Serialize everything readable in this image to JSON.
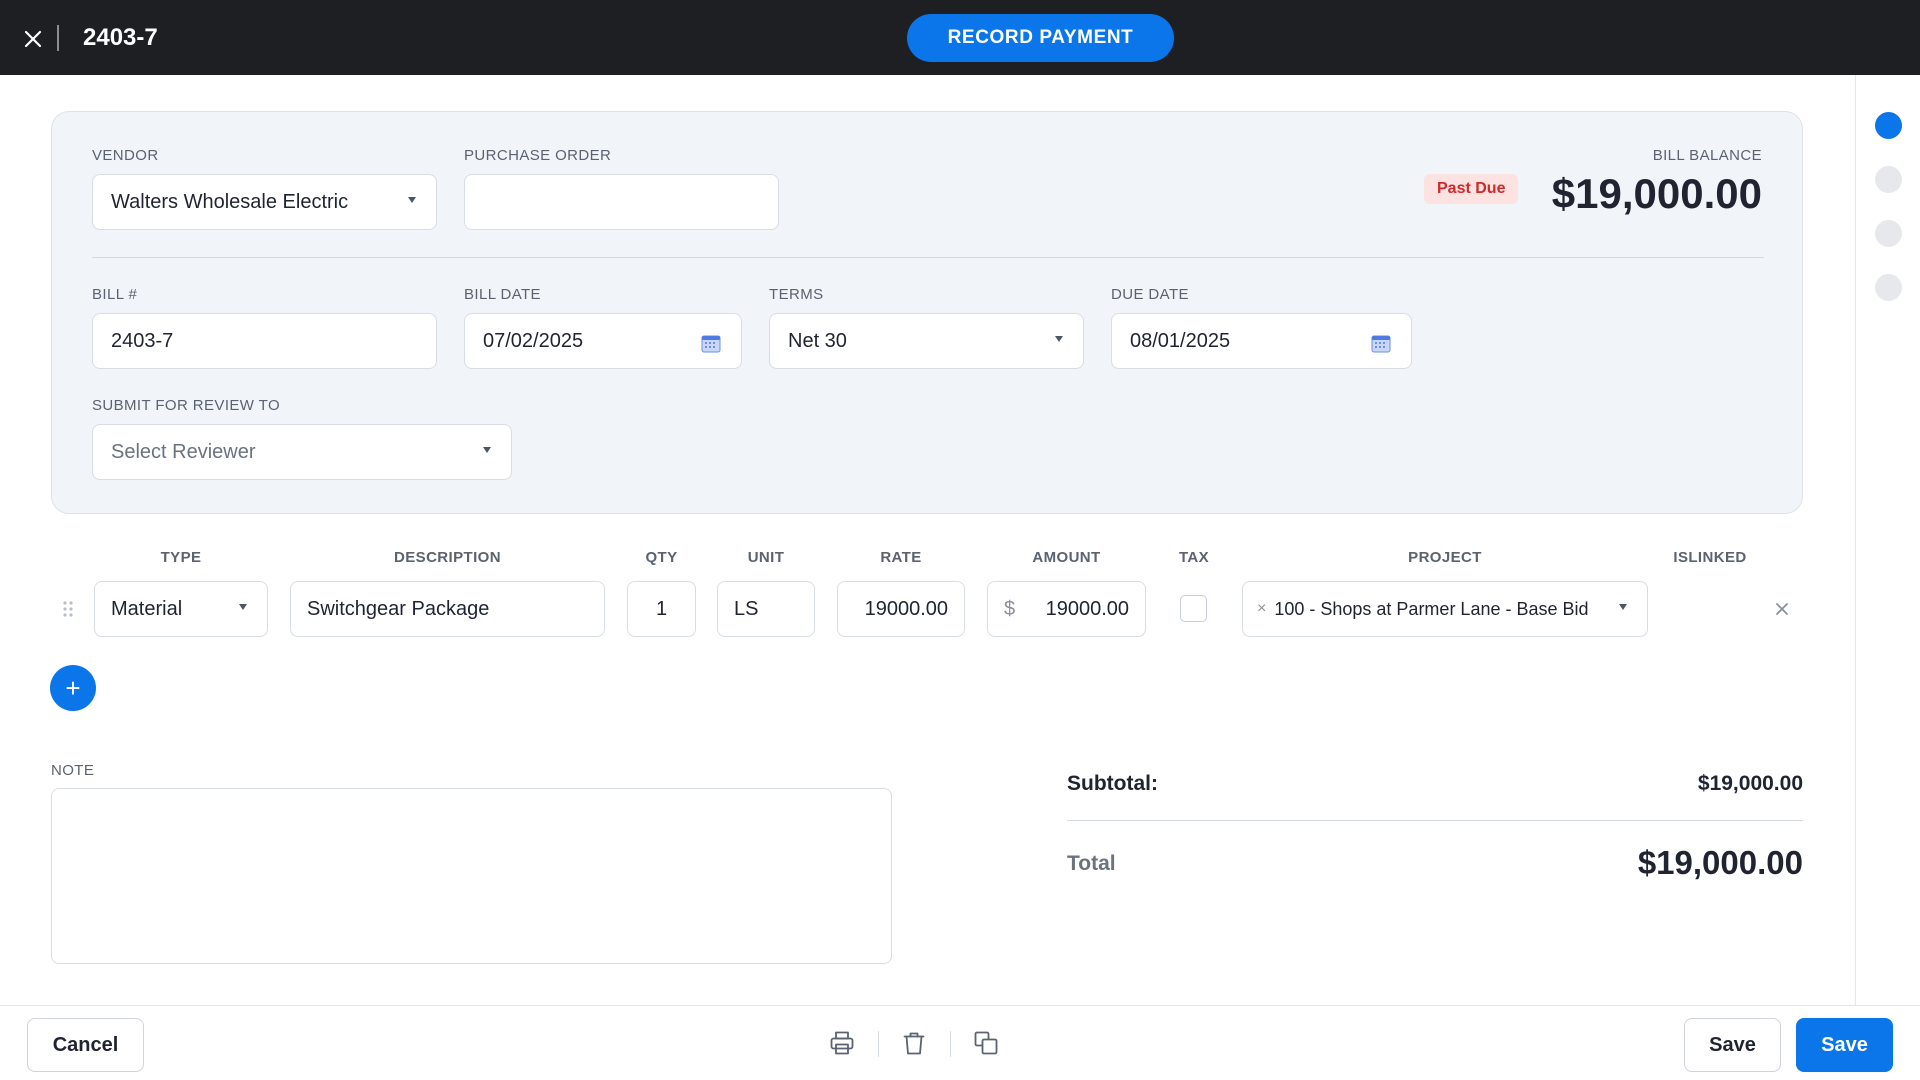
{
  "header": {
    "title": "2403-7",
    "record_payment_label": "RECORD PAYMENT"
  },
  "bill": {
    "vendor_label": "VENDOR",
    "vendor_value": "Walters Wholesale Electric",
    "po_label": "PURCHASE ORDER",
    "po_value": "",
    "balance_label": "BILL BALANCE",
    "balance_amount": "$19,000.00",
    "status_badge": "Past Due",
    "bill_no_label": "BILL #",
    "bill_no_value": "2403-7",
    "bill_date_label": "BILL DATE",
    "bill_date_value": "07/02/2025",
    "terms_label": "TERMS",
    "terms_value": "Net 30",
    "due_date_label": "DUE DATE",
    "due_date_value": "08/01/2025",
    "reviewer_label": "SUBMIT FOR REVIEW TO",
    "reviewer_placeholder": "Select Reviewer"
  },
  "line_items": {
    "headers": [
      "TYPE",
      "DESCRIPTION",
      "QTY",
      "UNIT",
      "RATE",
      "AMOUNT",
      "TAX",
      "PROJECT",
      "ISLINKED"
    ],
    "rows": [
      {
        "type": "Material",
        "description": "Switchgear Package",
        "qty": "1",
        "unit": "LS",
        "rate": "19000.00",
        "currency_symbol": "$",
        "amount": "19000.00",
        "tax": false,
        "project": "100 - Shops at Parmer Lane - Base Bid",
        "project_clear": "×"
      }
    ],
    "add_label": "+"
  },
  "note": {
    "label": "NOTE",
    "value": ""
  },
  "totals": {
    "subtotal_label": "Subtotal:",
    "subtotal_value": "$19,000.00",
    "total_label": "Total",
    "total_value": "$19,000.00"
  },
  "footer": {
    "cancel_label": "Cancel",
    "save_secondary_label": "Save",
    "save_primary_label": "Save",
    "icons": [
      "printer-icon",
      "trash-icon",
      "duplicate-icon"
    ]
  },
  "colors": {
    "accent": "#0b76ea",
    "topbar": "#1d1f23",
    "card_bg": "#f1f4f8",
    "past_due_bg": "#fde2e2",
    "past_due_text": "#d02a2a"
  }
}
